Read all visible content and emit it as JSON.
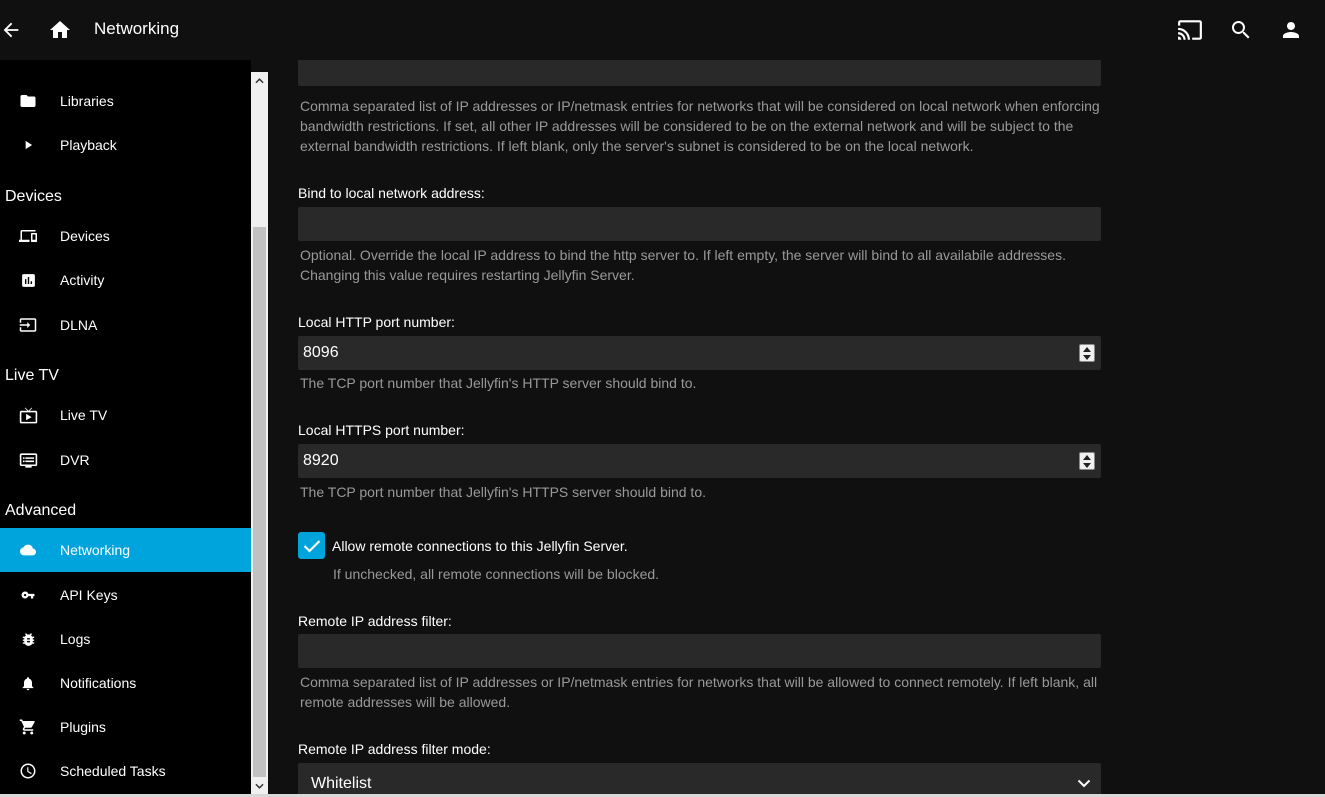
{
  "header": {
    "title": "Networking",
    "icons": [
      "back-arrow-icon",
      "home-icon",
      "cast-icon",
      "search-icon",
      "user-icon"
    ]
  },
  "sidebar": {
    "top_items": [
      {
        "label": "Libraries",
        "icon": "folder-icon"
      },
      {
        "label": "Playback",
        "icon": "play-icon"
      }
    ],
    "sections": [
      {
        "title": "Devices",
        "items": [
          {
            "label": "Devices",
            "icon": "devices-icon"
          },
          {
            "label": "Activity",
            "icon": "activity-icon"
          },
          {
            "label": "DLNA",
            "icon": "input-icon"
          }
        ]
      },
      {
        "title": "Live TV",
        "items": [
          {
            "label": "Live TV",
            "icon": "live-tv-icon"
          },
          {
            "label": "DVR",
            "icon": "dvr-icon"
          }
        ]
      },
      {
        "title": "Advanced",
        "items": [
          {
            "label": "Networking",
            "icon": "cloud-icon",
            "active": true
          },
          {
            "label": "API Keys",
            "icon": "key-icon"
          },
          {
            "label": "Logs",
            "icon": "bug-icon"
          },
          {
            "label": "Notifications",
            "icon": "bell-icon"
          },
          {
            "label": "Plugins",
            "icon": "cart-icon"
          },
          {
            "label": "Scheduled Tasks",
            "icon": "clock-icon"
          }
        ]
      }
    ]
  },
  "form": {
    "local_network_desc": "Comma separated list of IP addresses or IP/netmask entries for networks that will be considered on local network when enforcing bandwidth restrictions. If set, all other IP addresses will be considered to be on the external network and will be subject to the external bandwidth restrictions. If left blank, only the server's subnet is considered to be on the local network.",
    "bind_label": "Bind to local network address:",
    "bind_value": "",
    "bind_desc": "Optional. Override the local IP address to bind the http server to. If left empty, the server will bind to all availabile addresses. Changing this value requires restarting Jellyfin Server.",
    "http_label": "Local HTTP port number:",
    "http_value": "8096",
    "http_desc": "The TCP port number that Jellyfin's HTTP server should bind to.",
    "https_label": "Local HTTPS port number:",
    "https_value": "8920",
    "https_desc": "The TCP port number that Jellyfin's HTTPS server should bind to.",
    "remote_checkbox_label": "Allow remote connections to this Jellyfin Server.",
    "remote_checkbox_checked": true,
    "remote_checkbox_desc": "If unchecked, all remote connections will be blocked.",
    "filter_label": "Remote IP address filter:",
    "filter_value": "",
    "filter_desc": "Comma separated list of IP addresses or IP/netmask entries for networks that will be allowed to connect remotely. If left blank, all remote addresses will be allowed.",
    "filter_mode_label": "Remote IP address filter mode:",
    "filter_mode_value": "Whitelist"
  },
  "colors": {
    "accent": "#00a4dc",
    "background": "#101010",
    "sidebar": "#000000",
    "input": "#292929",
    "muted_text": "#999999"
  }
}
